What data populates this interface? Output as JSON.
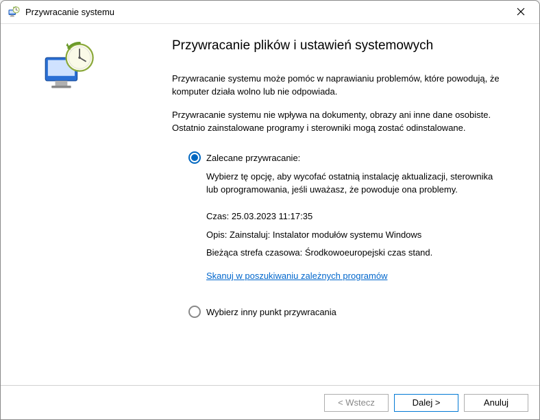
{
  "titlebar": {
    "title": "Przywracanie systemu"
  },
  "content": {
    "heading": "Przywracanie plików i ustawień systemowych",
    "para1": "Przywracanie systemu może pomóc w naprawianiu problemów, które powodują, że komputer działa wolno lub nie odpowiada.",
    "para2": "Przywracanie systemu nie wpływa na dokumenty, obrazy ani inne dane osobiste. Ostatnio zainstalowane programy i sterowniki mogą zostać odinstalowane.",
    "option_recommended": {
      "label": "Zalecane przywracanie:",
      "desc": "Wybierz tę opcję, aby wycofać ostatnią instalację aktualizacji, sterownika lub oprogramowania, jeśli uważasz, że powoduje ona problemy.",
      "time_label": "Czas:",
      "time_value": "25.03.2023 11:17:35",
      "desc_label": "Opis:",
      "desc_value": "Zainstaluj: Instalator modułów systemu Windows",
      "tz_label": "Bieżąca strefa czasowa:",
      "tz_value": "Środkowoeuropejski czas stand.",
      "scan_link": "Skanuj w poszukiwaniu zależnych programów"
    },
    "option_other": {
      "label": "Wybierz inny punkt przywracania"
    }
  },
  "footer": {
    "back": "< Wstecz",
    "next": "Dalej >",
    "cancel": "Anuluj"
  },
  "colors": {
    "accent": "#0067c0",
    "link": "#0066cc"
  }
}
